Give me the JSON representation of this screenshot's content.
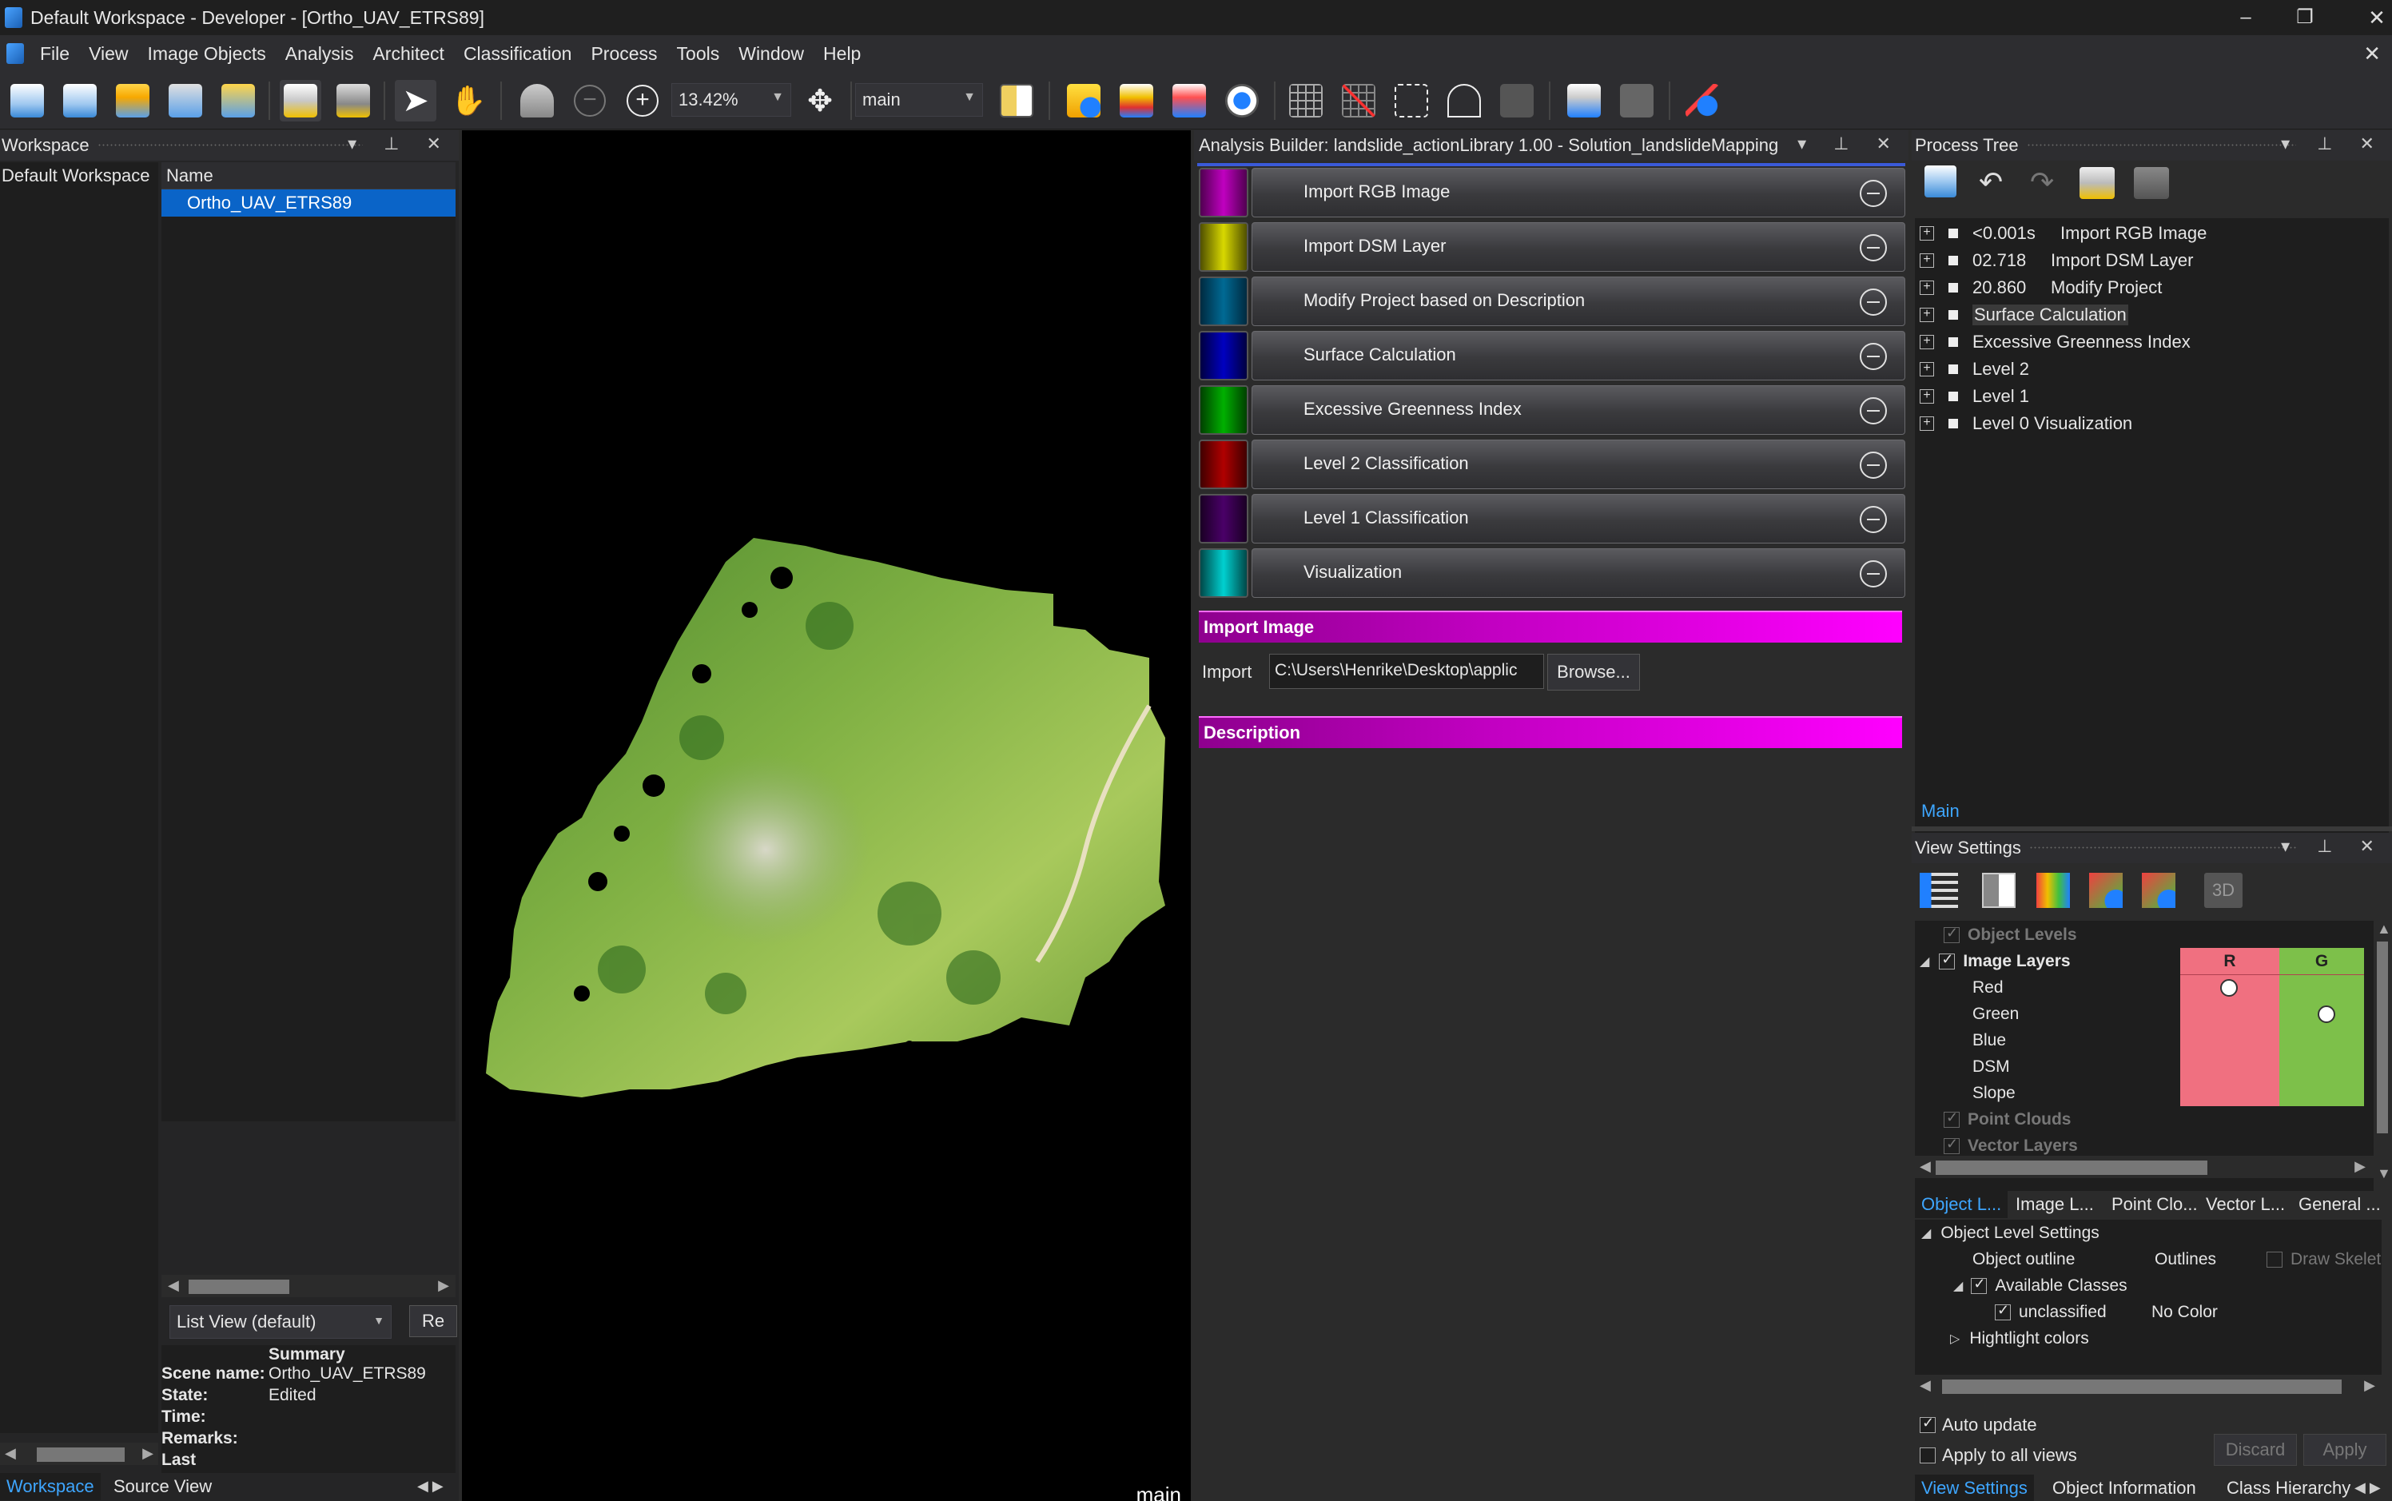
{
  "window": {
    "title": "Default Workspace - Developer - [Ortho_UAV_ETRS89]",
    "controls": [
      "–",
      "❐",
      "✕"
    ],
    "close_doc": "✕"
  },
  "menu": [
    "File",
    "View",
    "Image Objects",
    "Analysis",
    "Architect",
    "Classification",
    "Process",
    "Tools",
    "Window",
    "Help"
  ],
  "toolbar": {
    "zoom": "13.42%",
    "map": "main"
  },
  "workspace": {
    "header": "Workspace",
    "tree_root": "Default Workspace",
    "column_name": "Name",
    "selected_item": "Ortho_UAV_ETRS89",
    "view_mode": "List View (default)",
    "re_button": "Re",
    "summary_title": "Summary",
    "summary": [
      {
        "key": "Scene name:",
        "value": "Ortho_UAV_ETRS89"
      },
      {
        "key": "State:",
        "value": "Edited"
      },
      {
        "key": "Time:",
        "value": ""
      },
      {
        "key": "Remarks:",
        "value": ""
      },
      {
        "key": "Last",
        "value": ""
      }
    ],
    "bottom_tabs": [
      "Workspace",
      "Source View"
    ]
  },
  "image_view": {
    "label": "main"
  },
  "analysis_builder": {
    "title": "Analysis Builder: landslide_actionLibrary 1.00 - Solution_landslideMapping",
    "actions": [
      {
        "label": "Import RGB Image",
        "color": "#b000b0"
      },
      {
        "label": "Import DSM Layer",
        "color": "#c8c800"
      },
      {
        "label": "Modify Project based on Description",
        "color": "#005a80"
      },
      {
        "label": "Surface Calculation",
        "color": "#0000b0"
      },
      {
        "label": "Excessive Greenness Index",
        "color": "#00a000"
      },
      {
        "label": "Level 2 Classification",
        "color": "#a00000"
      },
      {
        "label": "Level 1 Classification",
        "color": "#3a0050"
      },
      {
        "label": "Visualization",
        "color": "#00c0c0"
      }
    ],
    "section_import": "Import Image",
    "import_label": "Import",
    "import_path": "C:\\Users\\Henrike\\Desktop\\applic",
    "browse_button": "Browse...",
    "section_description": "Description"
  },
  "process_tree": {
    "header": "Process Tree",
    "items": [
      {
        "time": "<0.001s",
        "label": "Import RGB Image"
      },
      {
        "time": "02.718",
        "label": "Import DSM Layer"
      },
      {
        "time": "20.860",
        "label": "Modify Project"
      },
      {
        "time": "",
        "label": "Surface Calculation"
      },
      {
        "time": "",
        "label": "Excessive Greenness Index"
      },
      {
        "time": "",
        "label": "Level 2"
      },
      {
        "time": "",
        "label": "Level 1"
      },
      {
        "time": "",
        "label": "Level 0 Visualization"
      }
    ],
    "tab": "Main"
  },
  "view_settings": {
    "header": "View Settings",
    "three_d": "3D",
    "object_levels": "Object Levels",
    "image_layers": "Image Layers",
    "channel_r": "R",
    "channel_g": "G",
    "layers": [
      "Red",
      "Green",
      "Blue",
      "DSM",
      "Slope"
    ],
    "point_clouds": "Point Clouds",
    "vector_layers": "Vector Layers",
    "sub_tabs": [
      "Object L...",
      "Image L...",
      "Point Clo...",
      "Vector L...",
      "General ..."
    ],
    "object_level_settings": "Object Level Settings",
    "object_outline": "Object outline",
    "outlines": "Outlines",
    "draw_skeleton": "Draw Skelet",
    "available_classes": "Available Classes",
    "unclassified": "unclassified",
    "no_color": "No Color",
    "highlight_colors": "Hightlight colors",
    "auto_update": "Auto update",
    "apply_all": "Apply to all views",
    "discard": "Discard",
    "apply": "Apply",
    "bottom_tabs": [
      "View Settings",
      "Object Information",
      "Class Hierarchy"
    ]
  },
  "colors": {
    "accent": "#3ea6ff",
    "selection": "#0a64c8",
    "magenta": "#ff00ff",
    "red_channel": "#f07080",
    "green_channel": "#7dc04a"
  }
}
